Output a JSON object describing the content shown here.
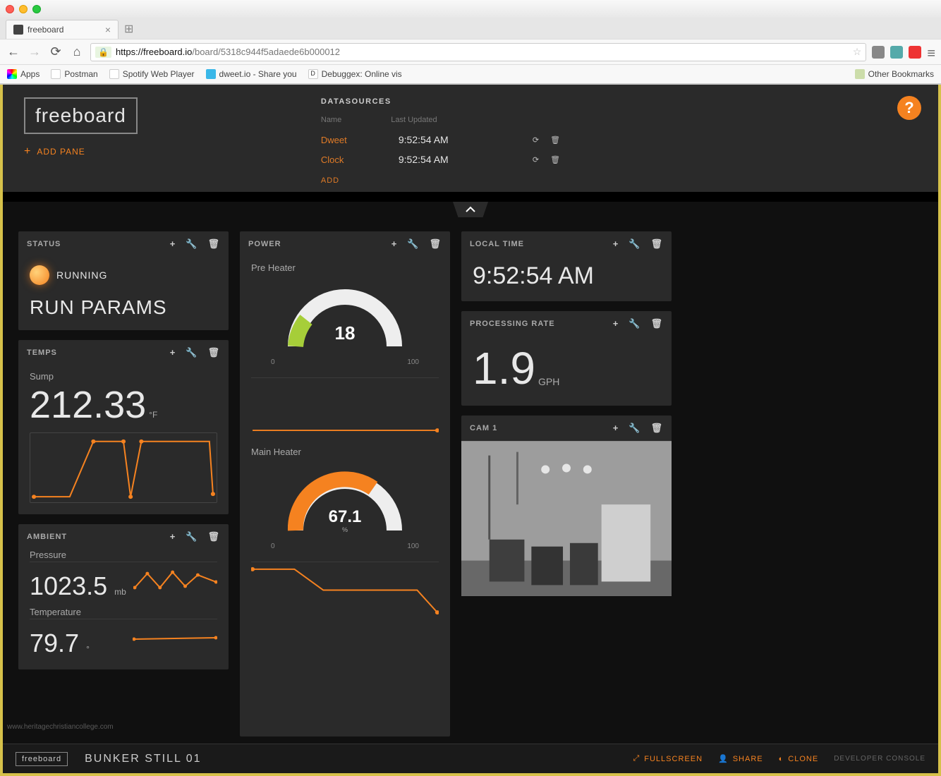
{
  "browser": {
    "tab_title": "freeboard",
    "url_domain": "https://freeboard.io",
    "url_path": "/board/5318c944f5adaede6b000012",
    "bookmarks": {
      "apps": "Apps",
      "items": [
        "Postman",
        "Spotify Web Player",
        "dweet.io - Share you",
        "Debuggex: Online vis"
      ],
      "other": "Other Bookmarks"
    }
  },
  "header": {
    "logo": "freeboard",
    "add_pane": "ADD PANE",
    "help_icon": "?",
    "datasources_title": "DATASOURCES",
    "col_name": "Name",
    "col_updated": "Last Updated",
    "rows": [
      {
        "name": "Dweet",
        "time": "9:52:54 AM"
      },
      {
        "name": "Clock",
        "time": "9:52:54 AM"
      }
    ],
    "add": "ADD"
  },
  "panes": {
    "status": {
      "title": "STATUS",
      "running": "RUNNING",
      "run_params": "RUN PARAMS"
    },
    "temps": {
      "title": "TEMPS",
      "label": "Sump",
      "value": "212.33",
      "unit": "°F"
    },
    "ambient": {
      "title": "AMBIENT",
      "pressure_label": "Pressure",
      "pressure_value": "1023.5",
      "pressure_unit": "mb",
      "temp_label": "Temperature",
      "temp_value": "79.7",
      "temp_unit": "°"
    },
    "power": {
      "title": "POWER",
      "pre_label": "Pre Heater",
      "pre_value": "18",
      "pre_min": "0",
      "pre_max": "100",
      "main_label": "Main Heater",
      "main_value": "67.1",
      "main_unit": "%",
      "main_min": "0",
      "main_max": "100"
    },
    "local_time": {
      "title": "LOCAL TIME",
      "value": "9:52:54 AM"
    },
    "rate": {
      "title": "PROCESSING RATE",
      "value": "1.9",
      "unit": "GPH"
    },
    "cam": {
      "title": "CAM 1"
    }
  },
  "footer": {
    "mini_logo": "freeboard",
    "dash_name": "BUNKER STILL 01",
    "fullscreen": "FULLSCREEN",
    "share": "SHARE",
    "clone": "CLONE",
    "devcon": "DEVELOPER CONSOLE"
  },
  "chart_data": [
    {
      "type": "line",
      "name": "temps_sump_sparkline",
      "ylim": [
        180,
        215
      ],
      "x": [
        0,
        1,
        2,
        3,
        4,
        5,
        6,
        7,
        8,
        9
      ],
      "values": [
        182,
        182,
        212,
        212,
        182,
        212,
        212,
        212,
        212,
        185
      ]
    },
    {
      "type": "line",
      "name": "ambient_pressure_spark",
      "x": [
        0,
        1,
        2,
        3,
        4,
        5,
        6
      ],
      "values": [
        1022,
        1025,
        1021,
        1026,
        1022,
        1025,
        1023.5
      ]
    },
    {
      "type": "line",
      "name": "ambient_temp_spark",
      "x": [
        0,
        1,
        2,
        3,
        4,
        5,
        6
      ],
      "values": [
        79.6,
        79.7,
        79.7,
        79.7,
        79.7,
        79.7,
        79.7
      ]
    },
    {
      "type": "line",
      "name": "power_pre_spark",
      "x": [
        0,
        1
      ],
      "values": [
        18,
        18
      ],
      "ylim": [
        0,
        100
      ]
    },
    {
      "type": "line",
      "name": "power_main_spark",
      "x": [
        0,
        1,
        2,
        3,
        4,
        5,
        6,
        7
      ],
      "values": [
        95,
        95,
        95,
        67,
        67,
        67,
        67,
        45
      ],
      "ylim": [
        0,
        100
      ]
    },
    {
      "type": "gauge",
      "name": "gauge_pre_heater",
      "value": 18,
      "min": 0,
      "max": 100
    },
    {
      "type": "gauge",
      "name": "gauge_main_heater",
      "value": 67.1,
      "min": 0,
      "max": 100
    }
  ],
  "watermark": "www.heritagechristiancollege.com"
}
